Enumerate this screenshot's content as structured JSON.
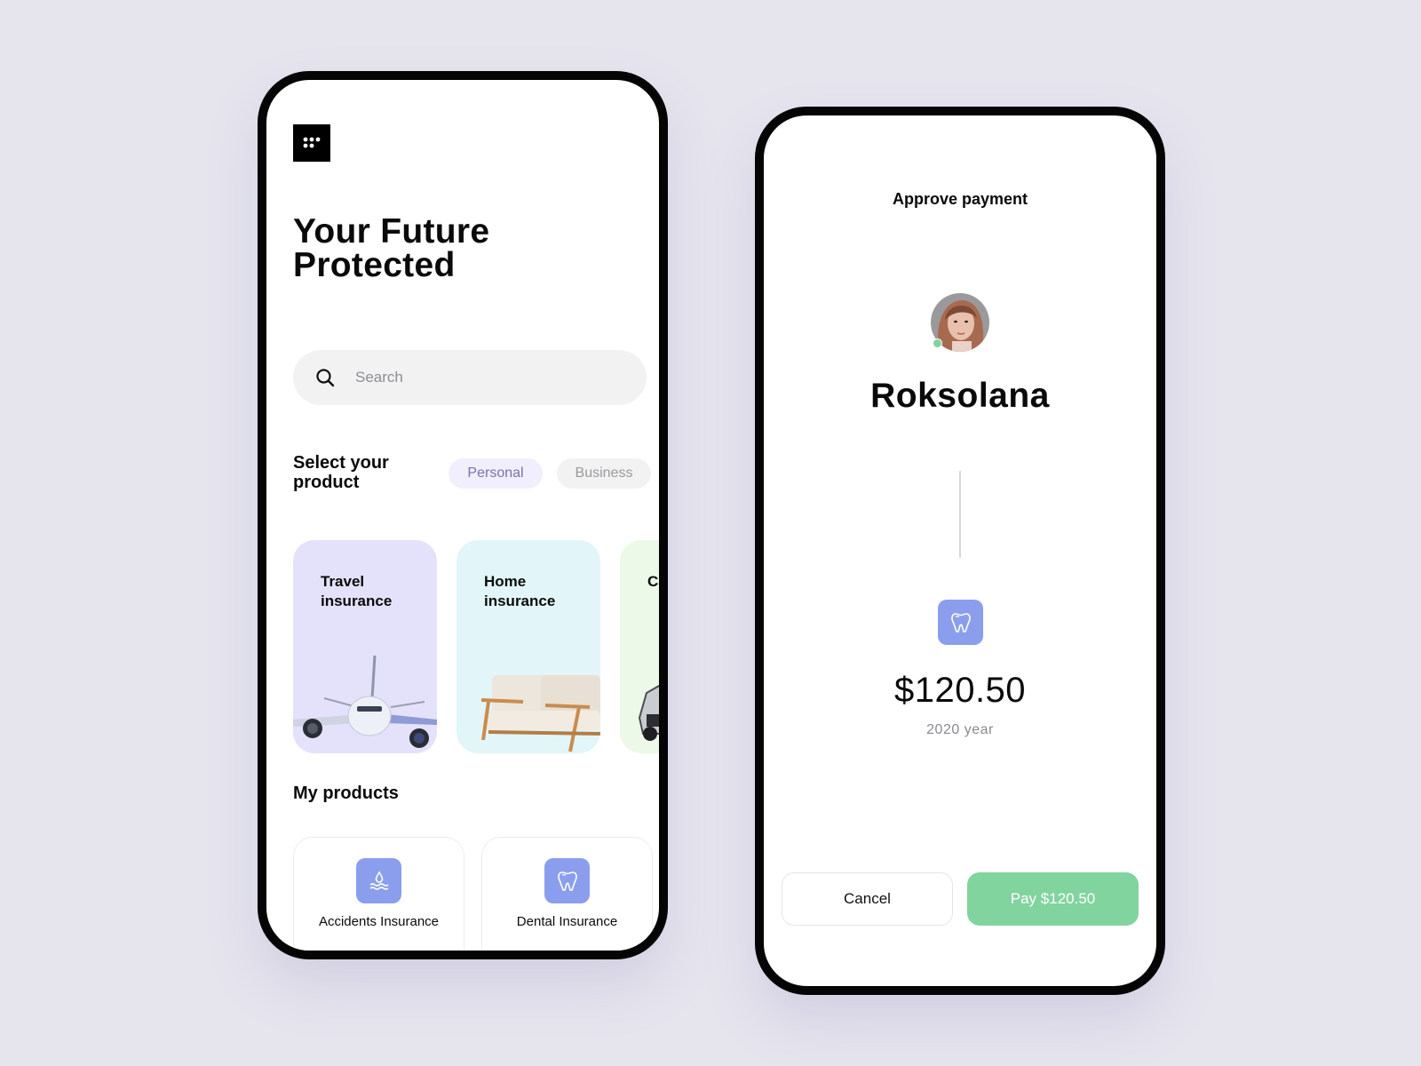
{
  "home_screen": {
    "menu_icon": "grid-dots-icon",
    "title": "Your Future Protected",
    "search": {
      "placeholder": "Search",
      "value": "",
      "icon": "search-icon"
    },
    "product_selector": {
      "label": "Select your product",
      "tabs": [
        {
          "label": "Personal",
          "selected": true
        },
        {
          "label": "Business",
          "selected": false
        }
      ]
    },
    "product_cards": [
      {
        "title": "Travel insurance",
        "image": "airplane",
        "color": "#e4e1fa"
      },
      {
        "title": "Home insurance",
        "image": "sofa",
        "color": "#e2f6f9"
      },
      {
        "title": "Car insurance",
        "image": "car",
        "color": "#ecf9e8"
      }
    ],
    "my_products": {
      "label": "My products",
      "items": [
        {
          "title": "Accidents Insurance",
          "icon": "water-drop-icon"
        },
        {
          "title": "Dental Insurance",
          "icon": "tooth-icon"
        }
      ]
    }
  },
  "payment_screen": {
    "title": "Approve payment",
    "payee": {
      "name": "Roksolana",
      "online": true
    },
    "product_icon": "tooth-icon",
    "amount": "$120.50",
    "period": "2020 year",
    "buttons": {
      "cancel": "Cancel",
      "pay": "Pay $120.50"
    }
  },
  "colors": {
    "accent_icon": "#8b9eed",
    "pay_green": "#82d49e",
    "chip_personal_text": "#7771ae",
    "background": "#e6e5ee"
  }
}
